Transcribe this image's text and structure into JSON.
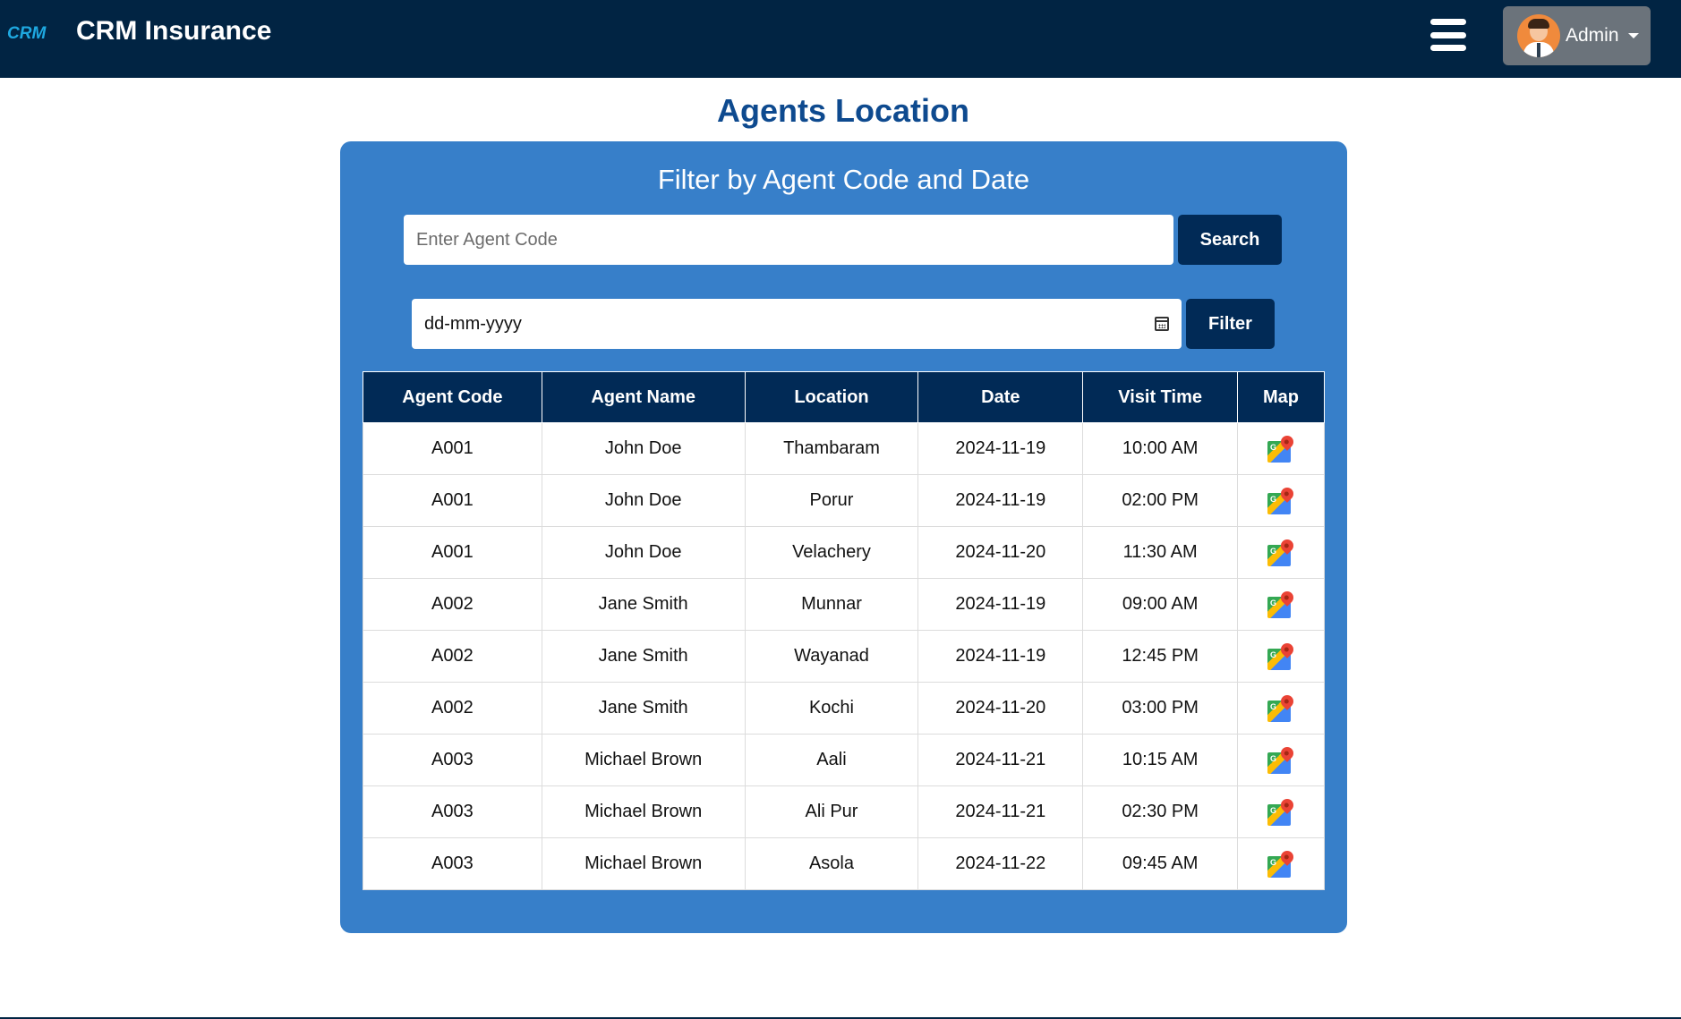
{
  "header": {
    "logo_text": "CRM",
    "brand": "CRM Insurance",
    "menu_icon": "hamburger-menu-icon",
    "user": {
      "label": "Admin",
      "avatar_icon": "user-avatar-icon"
    }
  },
  "page": {
    "title": "Agents Location"
  },
  "filter": {
    "title": "Filter by Agent Code and Date",
    "agent_code_placeholder": "Enter Agent Code",
    "agent_code_value": "",
    "search_label": "Search",
    "date_placeholder": "dd-mm-yyyy",
    "filter_label": "Filter"
  },
  "table": {
    "headers": [
      "Agent Code",
      "Agent Name",
      "Location",
      "Date",
      "Visit Time",
      "Map"
    ],
    "rows": [
      {
        "code": "A001",
        "name": "John Doe",
        "location": "Thambaram",
        "date": "2024-11-19",
        "time": "10:00 AM"
      },
      {
        "code": "A001",
        "name": "John Doe",
        "location": "Porur",
        "date": "2024-11-19",
        "time": "02:00 PM"
      },
      {
        "code": "A001",
        "name": "John Doe",
        "location": "Velachery",
        "date": "2024-11-20",
        "time": "11:30 AM"
      },
      {
        "code": "A002",
        "name": "Jane Smith",
        "location": "Munnar",
        "date": "2024-11-19",
        "time": "09:00 AM"
      },
      {
        "code": "A002",
        "name": "Jane Smith",
        "location": "Wayanad",
        "date": "2024-11-19",
        "time": "12:45 PM"
      },
      {
        "code": "A002",
        "name": "Jane Smith",
        "location": "Kochi",
        "date": "2024-11-20",
        "time": "03:00 PM"
      },
      {
        "code": "A003",
        "name": "Michael Brown",
        "location": "Aali",
        "date": "2024-11-21",
        "time": "10:15 AM"
      },
      {
        "code": "A003",
        "name": "Michael Brown",
        "location": "Ali Pur",
        "date": "2024-11-21",
        "time": "02:30 PM"
      },
      {
        "code": "A003",
        "name": "Michael Brown",
        "location": "Asola",
        "date": "2024-11-22",
        "time": "09:45 AM"
      }
    ]
  },
  "colors": {
    "topbar": "#012443",
    "panel": "#377fc9",
    "button": "#012a56",
    "title": "#0e4a8f"
  }
}
